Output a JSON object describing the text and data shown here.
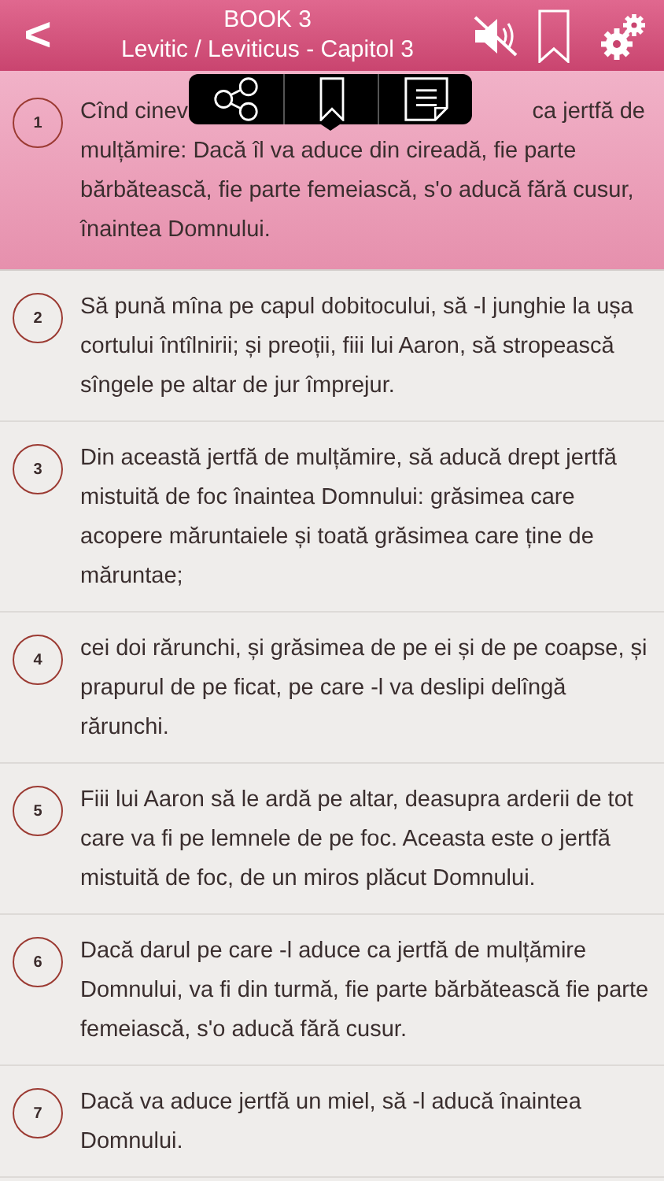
{
  "header": {
    "back": "<",
    "book": "BOOK 3",
    "chapter": "Levitic / Leviticus - Capitol 3",
    "sound_muted": true
  },
  "popup": {
    "actions": [
      {
        "kind": "share"
      },
      {
        "kind": "bookmark"
      },
      {
        "kind": "note"
      }
    ]
  },
  "verses": [
    {
      "number": "1",
      "selected": true,
      "text_start": "Cînd cinev",
      "text_line_end": "ca jertfă de",
      "text_rest": "mulțămire: Dacă îl va aduce din cireadă, fie parte bărbătească, fie parte femeiască, s'o aducă fără cusur, înaintea Domnului."
    },
    {
      "number": "2",
      "selected": false,
      "text": "Să pună mîna pe capul dobitocului, să -l junghie la ușa cortului întîlnirii; și preoții, fiii lui Aaron, să stropească sîngele pe altar de jur împrejur."
    },
    {
      "number": "3",
      "selected": false,
      "text": "Din această jertfă de mulțămire, să aducă drept jertfă mistuită de foc înaintea Domnului: grăsimea care acopere măruntaiele și toată grăsimea care ține de măruntae;"
    },
    {
      "number": "4",
      "selected": false,
      "text": "cei doi rărunchi, și grăsimea de pe ei și de pe coapse, și prapurul de pe ficat, pe care -l va deslipi delîngă rărunchi."
    },
    {
      "number": "5",
      "selected": false,
      "text": "Fiii lui Aaron să le ardă pe altar, deasupra arderii de tot care va fi pe lemnele de pe foc. Aceasta este o jertfă mistuită de foc, de un miros plăcut Domnului."
    },
    {
      "number": "6",
      "selected": false,
      "text": "Dacă darul pe care -l aduce ca jertfă de mulțămire Domnului, va fi din turmă, fie parte bărbătească fie parte femeiască, s'o aducă fără cusur."
    },
    {
      "number": "7",
      "selected": false,
      "text": "Dacă va aduce jertfă un miel, să -l aducă înaintea Domnului."
    }
  ]
}
